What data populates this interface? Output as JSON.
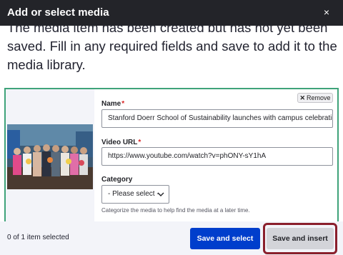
{
  "dialog": {
    "title": "Add or select media",
    "close_label": "×"
  },
  "message": {
    "text": "The media item has been created but has not yet been saved. Fill in any required fields and save to add it to the media library."
  },
  "media_item": {
    "remove_label": "Remove",
    "name_label": "Name",
    "name_value": "Stanford Doerr School of Sustainability launches with campus celebration",
    "video_url_label": "Video URL",
    "video_url_value": "https://www.youtube.com/watch?v=phONY-sY1hA",
    "category_label": "Category",
    "category_selected": "- Please select -",
    "category_help": "Categorize the media to help find the media at a later time.",
    "required_marker": "*"
  },
  "footer": {
    "selected_count": "0 of 1 item selected",
    "save_and_select_label": "Save and select",
    "save_and_insert_label": "Save and insert"
  },
  "colors": {
    "titlebar_bg": "#232429",
    "primary_button": "#003ecc",
    "media_border": "#3fa37a",
    "highlight_ring": "#8a1f2c",
    "required": "#d72222"
  },
  "icons": {
    "close": "close-icon",
    "remove": "x-icon",
    "select_chevron": "chevron-down-icon"
  }
}
